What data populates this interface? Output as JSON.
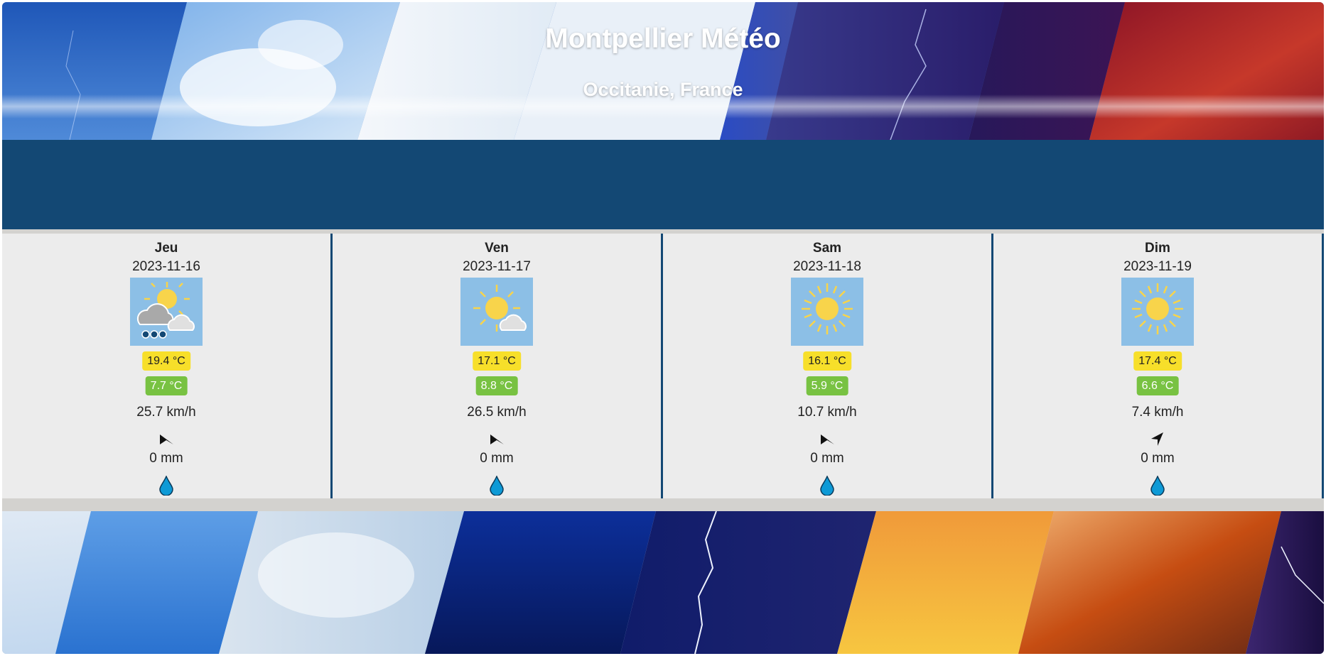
{
  "header": {
    "title": "Montpellier Météo",
    "subtitle": "Occitanie, France"
  },
  "days": [
    {
      "name": "Jeu",
      "date": "2023-11-16",
      "icon": "sun-cloud-rain-icon",
      "temp_max": "19.4 °C",
      "temp_min": "7.7 °C",
      "wind": "25.7 km/h",
      "wind_direction_deg": 240,
      "rain": "0 mm"
    },
    {
      "name": "Ven",
      "date": "2023-11-17",
      "icon": "sun-small-cloud-icon",
      "temp_max": "17.1 °C",
      "temp_min": "8.8 °C",
      "wind": "26.5 km/h",
      "wind_direction_deg": 240,
      "rain": "0 mm"
    },
    {
      "name": "Sam",
      "date": "2023-11-18",
      "icon": "sun-icon",
      "temp_max": "16.1 °C",
      "temp_min": "5.9 °C",
      "wind": "10.7 km/h",
      "wind_direction_deg": 240,
      "rain": "0 mm"
    },
    {
      "name": "Dim",
      "date": "2023-11-19",
      "icon": "sun-icon",
      "temp_max": "17.4 °C",
      "temp_min": "6.6 °C",
      "wind": "7.4 km/h",
      "wind_direction_deg": 200,
      "rain": "0 mm"
    }
  ],
  "colors": {
    "band": "#134874",
    "card_bg": "#ececec",
    "temp_max_badge": "#f7df2a",
    "temp_min_badge": "#78c242",
    "icon_bg": "#8cbfe6",
    "sun": "#f8d44b",
    "rain_drop": "#0e9ad6"
  }
}
